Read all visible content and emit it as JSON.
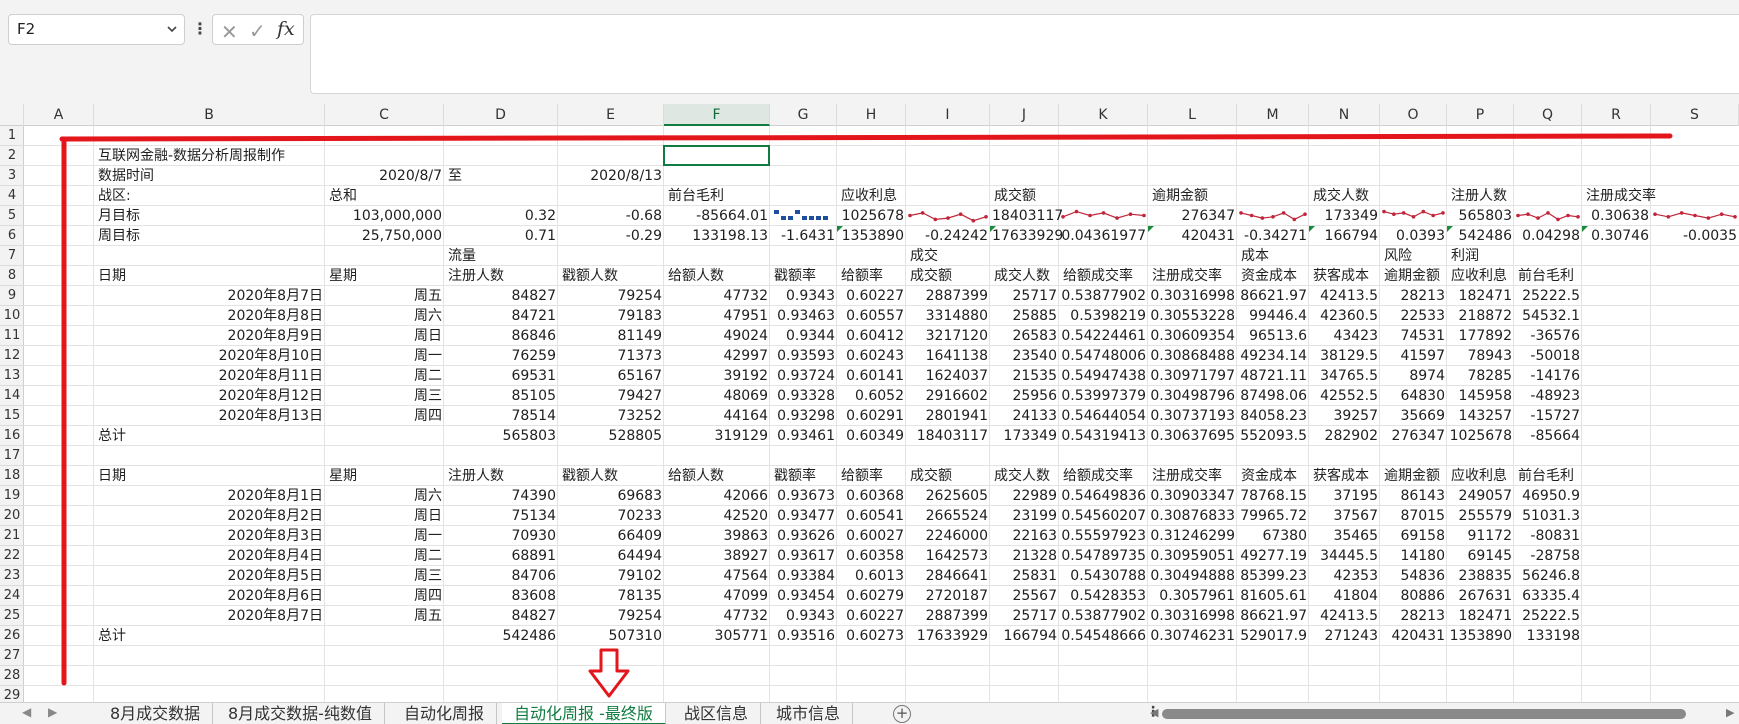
{
  "formula_bar": {
    "name_box": "F2",
    "fx_label": "fx",
    "formula": ""
  },
  "columns": [
    "A",
    "B",
    "C",
    "D",
    "E",
    "F",
    "G",
    "H",
    "I",
    "J",
    "K",
    "L",
    "M",
    "N",
    "O",
    "P",
    "Q",
    "R",
    "S"
  ],
  "rows": [
    "1",
    "2",
    "3",
    "4",
    "5",
    "6",
    "7",
    "8",
    "9",
    "10",
    "11",
    "12",
    "13",
    "14",
    "15",
    "16",
    "17",
    "18",
    "19",
    "20",
    "21",
    "22",
    "23",
    "24",
    "25",
    "26",
    "27",
    "28",
    "29"
  ],
  "selected_cell": "F2",
  "cells": {
    "r2": {
      "B": "互联网金融-数据分析周报制作"
    },
    "r3": {
      "B": "数据时间",
      "C": "2020/8/7",
      "D": "至",
      "E": "2020/8/13"
    },
    "r4": {
      "B": "战区:",
      "C": "总和",
      "F": "前台毛利",
      "H": "应收利息",
      "J": "成交额",
      "L": "逾期金额",
      "N": "成交人数",
      "P": "注册人数",
      "R": "注册成交率"
    },
    "r5": {
      "B": "月目标",
      "C": "103,000,000",
      "D": "0.32",
      "E": "-0.68",
      "F": "-85664.01",
      "H": "1025678",
      "J": "18403117",
      "L": "276347",
      "N": "173349",
      "P": "565803",
      "R": "0.30638"
    },
    "r6": {
      "B": "周目标",
      "C": "25,750,000",
      "D": "0.71",
      "E": "-0.29",
      "F": "133198.13",
      "G": "-1.6431",
      "H": "1353890",
      "I": "-0.24242",
      "J": "17633929",
      "K": "0.04361977",
      "L": "420431",
      "M": "-0.34271",
      "N": "166794",
      "O": "0.0393",
      "P": "542486",
      "Q": "0.04298",
      "R": "0.30746",
      "S": "-0.0035"
    },
    "r7": {
      "D": "流量",
      "I": "成交",
      "M": "成本",
      "O": "风险",
      "P": "利润"
    },
    "r8": {
      "B": "日期",
      "C": "星期",
      "D": "注册人数",
      "E": "戳额人数",
      "F": "给额人数",
      "G": "戳额率",
      "H": "给额率",
      "I": "成交额",
      "J": "成交人数",
      "K": "给额成交率",
      "L": "注册成交率",
      "M": "资金成本",
      "N": "获客成本",
      "O": "逾期金额",
      "P": "应收利息",
      "Q": "前台毛利"
    },
    "r9": {
      "B": "2020年8月7日",
      "C": "周五",
      "D": "84827",
      "E": "79254",
      "F": "47732",
      "G": "0.9343",
      "H": "0.60227",
      "I": "2887399",
      "J": "25717",
      "K": "0.53877902",
      "L": "0.30316998",
      "M": "86621.97",
      "N": "42413.5",
      "O": "28213",
      "P": "182471",
      "Q": "25222.5"
    },
    "r10": {
      "B": "2020年8月8日",
      "C": "周六",
      "D": "84721",
      "E": "79183",
      "F": "47951",
      "G": "0.93463",
      "H": "0.60557",
      "I": "3314880",
      "J": "25885",
      "K": "0.5398219",
      "L": "0.30553228",
      "M": "99446.4",
      "N": "42360.5",
      "O": "22533",
      "P": "218872",
      "Q": "54532.1"
    },
    "r11": {
      "B": "2020年8月9日",
      "C": "周日",
      "D": "86846",
      "E": "81149",
      "F": "49024",
      "G": "0.9344",
      "H": "0.60412",
      "I": "3217120",
      "J": "26583",
      "K": "0.54224461",
      "L": "0.30609354",
      "M": "96513.6",
      "N": "43423",
      "O": "74531",
      "P": "177892",
      "Q": "-36576"
    },
    "r12": {
      "B": "2020年8月10日",
      "C": "周一",
      "D": "76259",
      "E": "71373",
      "F": "42997",
      "G": "0.93593",
      "H": "0.60243",
      "I": "1641138",
      "J": "23540",
      "K": "0.54748006",
      "L": "0.30868488",
      "M": "49234.14",
      "N": "38129.5",
      "O": "41597",
      "P": "78943",
      "Q": "-50018"
    },
    "r13": {
      "B": "2020年8月11日",
      "C": "周二",
      "D": "69531",
      "E": "65167",
      "F": "39192",
      "G": "0.93724",
      "H": "0.60141",
      "I": "1624037",
      "J": "21535",
      "K": "0.54947438",
      "L": "0.30971797",
      "M": "48721.11",
      "N": "34765.5",
      "O": "8974",
      "P": "78285",
      "Q": "-14176"
    },
    "r14": {
      "B": "2020年8月12日",
      "C": "周三",
      "D": "85105",
      "E": "79427",
      "F": "48069",
      "G": "0.93328",
      "H": "0.6052",
      "I": "2916602",
      "J": "25956",
      "K": "0.53997379",
      "L": "0.30498796",
      "M": "87498.06",
      "N": "42552.5",
      "O": "64830",
      "P": "145958",
      "Q": "-48923"
    },
    "r15": {
      "B": "2020年8月13日",
      "C": "周四",
      "D": "78514",
      "E": "73252",
      "F": "44164",
      "G": "0.93298",
      "H": "0.60291",
      "I": "2801941",
      "J": "24133",
      "K": "0.54644054",
      "L": "0.30737193",
      "M": "84058.23",
      "N": "39257",
      "O": "35669",
      "P": "143257",
      "Q": "-15727"
    },
    "r16": {
      "B": "总计",
      "D": "565803",
      "E": "528805",
      "F": "319129",
      "G": "0.93461",
      "H": "0.60349",
      "I": "18403117",
      "J": "173349",
      "K": "0.54319413",
      "L": "0.30637695",
      "M": "552093.5",
      "N": "282902",
      "O": "276347",
      "P": "1025678",
      "Q": "-85664"
    },
    "r18": {
      "B": "日期",
      "C": "星期",
      "D": "注册人数",
      "E": "戳额人数",
      "F": "给额人数",
      "G": "戳额率",
      "H": "给额率",
      "I": "成交额",
      "J": "成交人数",
      "K": "给额成交率",
      "L": "注册成交率",
      "M": "资金成本",
      "N": "获客成本",
      "O": "逾期金额",
      "P": "应收利息",
      "Q": "前台毛利"
    },
    "r19": {
      "B": "2020年8月1日",
      "C": "周六",
      "D": "74390",
      "E": "69683",
      "F": "42066",
      "G": "0.93673",
      "H": "0.60368",
      "I": "2625605",
      "J": "22989",
      "K": "0.54649836",
      "L": "0.30903347",
      "M": "78768.15",
      "N": "37195",
      "O": "86143",
      "P": "249057",
      "Q": "46950.9"
    },
    "r20": {
      "B": "2020年8月2日",
      "C": "周日",
      "D": "75134",
      "E": "70233",
      "F": "42520",
      "G": "0.93477",
      "H": "0.60541",
      "I": "2665524",
      "J": "23199",
      "K": "0.54560207",
      "L": "0.30876833",
      "M": "79965.72",
      "N": "37567",
      "O": "87015",
      "P": "255579",
      "Q": "51031.3"
    },
    "r21": {
      "B": "2020年8月3日",
      "C": "周一",
      "D": "70930",
      "E": "66409",
      "F": "39863",
      "G": "0.93626",
      "H": "0.60027",
      "I": "2246000",
      "J": "22163",
      "K": "0.55597923",
      "L": "0.31246299",
      "M": "67380",
      "N": "35465",
      "O": "69158",
      "P": "91172",
      "Q": "-80831"
    },
    "r22": {
      "B": "2020年8月4日",
      "C": "周二",
      "D": "68891",
      "E": "64494",
      "F": "38927",
      "G": "0.93617",
      "H": "0.60358",
      "I": "1642573",
      "J": "21328",
      "K": "0.54789735",
      "L": "0.30959051",
      "M": "49277.19",
      "N": "34445.5",
      "O": "14180",
      "P": "69145",
      "Q": "-28758"
    },
    "r23": {
      "B": "2020年8月5日",
      "C": "周三",
      "D": "84706",
      "E": "79102",
      "F": "47564",
      "G": "0.93384",
      "H": "0.6013",
      "I": "2846641",
      "J": "25831",
      "K": "0.5430788",
      "L": "0.30494888",
      "M": "85399.23",
      "N": "42353",
      "O": "54836",
      "P": "238835",
      "Q": "56246.8"
    },
    "r24": {
      "B": "2020年8月6日",
      "C": "周四",
      "D": "83608",
      "E": "78135",
      "F": "47099",
      "G": "0.93454",
      "H": "0.60279",
      "I": "2720187",
      "J": "25567",
      "K": "0.5428353",
      "L": "0.3057961",
      "M": "81605.61",
      "N": "41804",
      "O": "80886",
      "P": "267631",
      "Q": "63335.4"
    },
    "r25": {
      "B": "2020年8月7日",
      "C": "周五",
      "D": "84827",
      "E": "79254",
      "F": "47732",
      "G": "0.9343",
      "H": "0.60227",
      "I": "2887399",
      "J": "25717",
      "K": "0.53877902",
      "L": "0.30316998",
      "M": "86621.97",
      "N": "42413.5",
      "O": "28213",
      "P": "182471",
      "Q": "25222.5"
    },
    "r26": {
      "B": "总计",
      "D": "542486",
      "E": "507310",
      "F": "305771",
      "G": "0.93516",
      "H": "0.60273",
      "I": "17633929",
      "J": "166794",
      "K": "0.54548666",
      "L": "0.30746231",
      "M": "529017.9",
      "N": "271243",
      "O": "420431",
      "P": "1353890",
      "Q": "133198"
    }
  },
  "sheet_tabs": [
    "8月成交数据",
    "8月成交数据-纯数值",
    "自动化周报",
    "自动化周报 -最终版",
    "战区信息",
    "城市信息"
  ],
  "active_tab": "自动化周报 -最终版",
  "colors": {
    "accent": "#107c41",
    "annotation": "#e3161c",
    "sparkline": "#c0253a",
    "winloss": "#1f4e9c"
  }
}
